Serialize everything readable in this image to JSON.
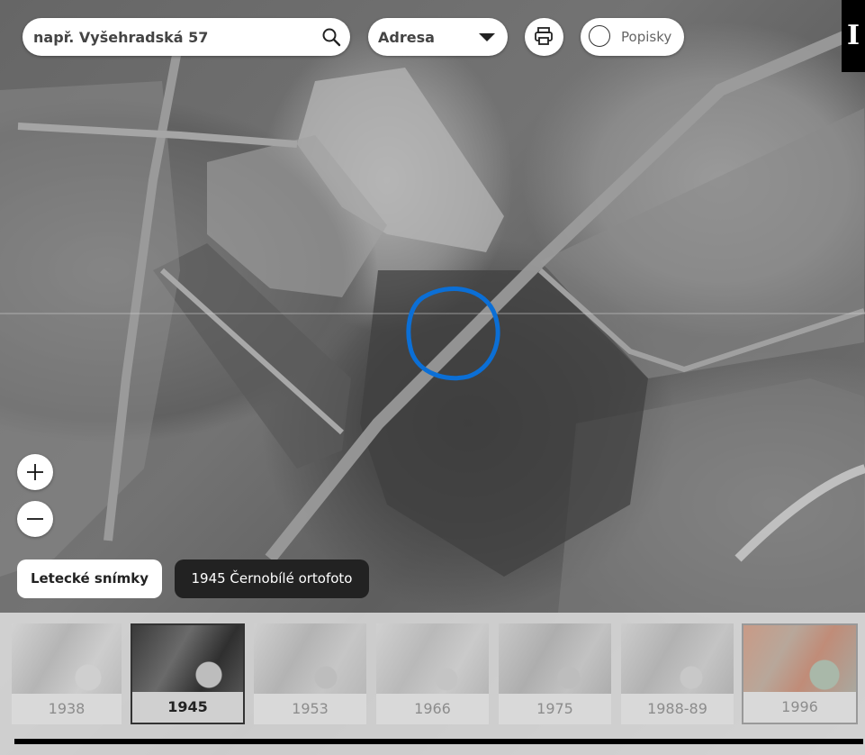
{
  "search": {
    "placeholder": "např. Vyšehradská 57",
    "icon": "search-icon"
  },
  "search_type": {
    "selected": "Adresa"
  },
  "print": {
    "icon": "printer-icon"
  },
  "labels_toggle": {
    "label": "Popisky",
    "checked": false
  },
  "info": {
    "label": "I"
  },
  "zoom": {
    "in": "zoom-in-icon",
    "out": "zoom-out-icon"
  },
  "layer": {
    "button_label": "Letecké snímky",
    "current_label": "1945 Černobílé ortofoto"
  },
  "timeline": {
    "years": [
      "1938",
      "1945",
      "1953",
      "1966",
      "1975",
      "1988-89",
      "1996"
    ],
    "active": "1945"
  },
  "colors": {
    "highlight_circle": "#0b6fd6",
    "panel_dark": "#222222"
  }
}
